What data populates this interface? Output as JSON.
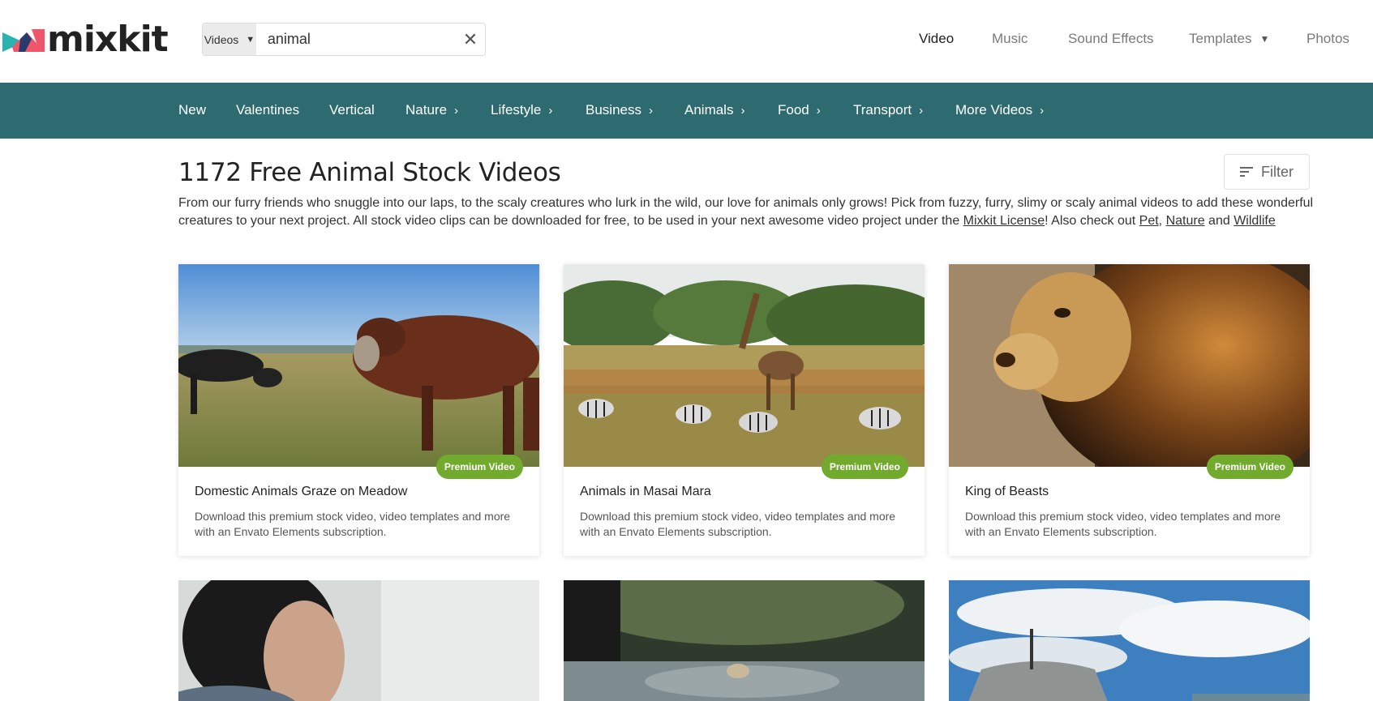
{
  "brand": {
    "name": "mixkit"
  },
  "search": {
    "type_label": "Videos",
    "value": "animal"
  },
  "top_nav": [
    {
      "label": "Video"
    },
    {
      "label": "Music"
    },
    {
      "label": "Sound Effects"
    },
    {
      "label": "Templates"
    },
    {
      "label": "Photos"
    }
  ],
  "categories": [
    {
      "label": "New"
    },
    {
      "label": "Valentines"
    },
    {
      "label": "Vertical"
    },
    {
      "label": "Nature"
    },
    {
      "label": "Lifestyle"
    },
    {
      "label": "Business"
    },
    {
      "label": "Animals"
    },
    {
      "label": "Food"
    },
    {
      "label": "Transport"
    },
    {
      "label": "More Videos"
    }
  ],
  "page": {
    "title": "1172 Free Animal Stock Videos",
    "filter_label": "Filter",
    "intro_text": "From our furry friends who snuggle into our laps, to the scaly creatures who lurk in the wild, our love for animals only grows! Pick from fuzzy, furry, slimy or scaly animal videos to add these wonderful creatures to your next project. All stock video clips can be downloaded for free, to be used in your next awesome video project under the ",
    "license_link": "Mixkit License",
    "intro_mid": "! Also check out ",
    "link_pet": "Pet",
    "link_nature": "Nature",
    "intro_and": "and",
    "link_wildlife": "Wildlife"
  },
  "videos": [
    {
      "title": "Domestic Animals Graze on Meadow",
      "badge": "Premium Video",
      "description": "Download this premium stock video, video templates and more with an Envato Elements subscription."
    },
    {
      "title": "Animals in Masai Mara",
      "badge": "Premium Video",
      "description": "Download this premium stock video, video templates and more with an Envato Elements subscription."
    },
    {
      "title": "King of Beasts",
      "badge": "Premium Video",
      "description": "Download this premium stock video, video templates and more with an Envato Elements subscription."
    }
  ],
  "colors": {
    "category_bar": "#2d6b70",
    "badge": "#72aa2e",
    "logo_teal": "#2bb3b0",
    "logo_coral": "#f0566a",
    "logo_navy": "#2a3a6a"
  }
}
